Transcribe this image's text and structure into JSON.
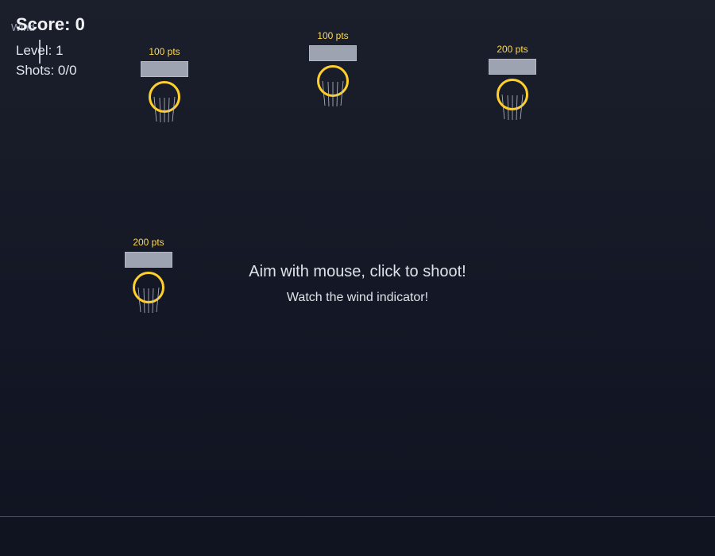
{
  "hud": {
    "score_label": "Score: 0",
    "level_label": "Level: 1",
    "shots_label": "Shots: 0/0",
    "wind_label": "Wind"
  },
  "hoops": [
    {
      "points_label": "100 pts"
    },
    {
      "points_label": "100 pts"
    },
    {
      "points_label": "200 pts"
    },
    {
      "points_label": "200 pts"
    }
  ],
  "messages": {
    "main": "Aim with mouse, click to shoot!",
    "sub": "Watch the wind indicator!"
  },
  "colors": {
    "rim": "#ffcf2a",
    "points_text": "#ffd84a",
    "backboard": "#9ea3b2",
    "background_top": "#1b1f2b",
    "background_bottom": "#101320"
  }
}
